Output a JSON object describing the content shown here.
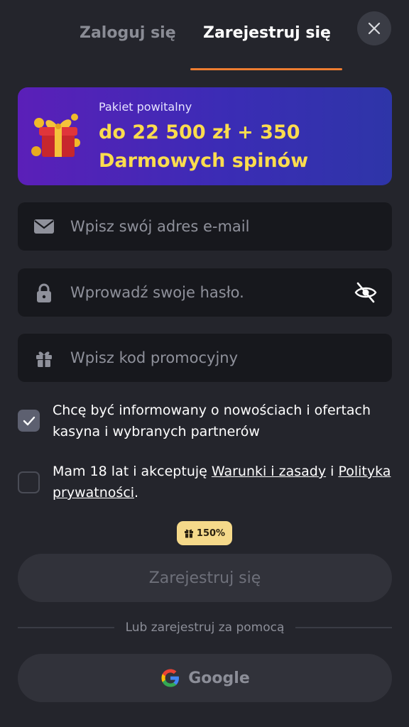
{
  "tabs": {
    "login": "Zaloguj się",
    "register": "Zarejestruj się"
  },
  "banner": {
    "subtitle": "Pakiet powitalny",
    "line1": "do 22 500 zł + 350",
    "line2": "Darmowych spinów"
  },
  "form": {
    "email_placeholder": "Wpisz swój adres e-mail",
    "password_placeholder": "Wprowadź swoje hasło.",
    "promo_placeholder": "Wpisz kod promocyjny"
  },
  "checks": {
    "newsletter": {
      "checked": true,
      "text": "Chcę być informowany o nowościach i ofertach kasyna i wybranych partnerów"
    },
    "terms": {
      "checked": false,
      "prefix": "Mam 18 lat i akceptuję ",
      "terms_link": "Warunki i zasady",
      "middle": " i ",
      "privacy_link": "Polityka prywatności",
      "suffix": "."
    }
  },
  "badge": {
    "text": "150%"
  },
  "buttons": {
    "register": "Zarejestruj się",
    "divider": "Lub zarejestruj za pomocą",
    "google": "Google"
  },
  "colors": {
    "accent": "#ee7d31",
    "banner_highlight": "#fbdc4e",
    "background": "#24252c",
    "field": "#17181d"
  },
  "icons": [
    "close-icon",
    "gift-icon",
    "mail-icon",
    "lock-icon",
    "eye-off-icon",
    "check-icon",
    "google-icon"
  ]
}
